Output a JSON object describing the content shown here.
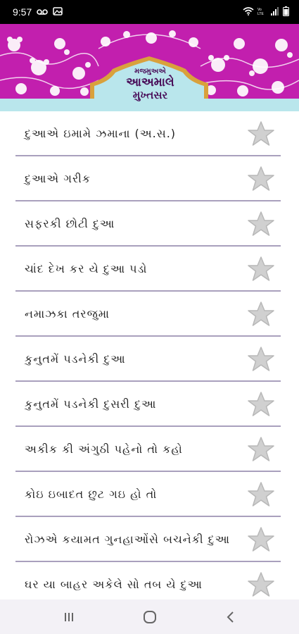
{
  "status_bar": {
    "time": "9:57",
    "icons": [
      "voicemail-icon",
      "gallery-icon",
      "wifi-icon",
      "volte-icon",
      "signal-icon",
      "battery-icon"
    ]
  },
  "header": {
    "title_line1": "મજમુઅએ",
    "title_line2": "આઅમાલે",
    "title_line3": "મુખ્તસર"
  },
  "colors": {
    "banner": "#c21fae",
    "banner_strip": "#b9e6ec",
    "divider": "#a9a0bd",
    "star": "#c9c9c9"
  },
  "list": {
    "items": [
      {
        "label": "દુઆએ ઇમામે ઝમાના (અ.સ.)",
        "icon": "star-outline-icon"
      },
      {
        "label": "દુઆએ ગરીક",
        "icon": "star-outline-icon"
      },
      {
        "label": "સફરકી છોટી દુઆ",
        "icon": "star-outline-icon"
      },
      {
        "label": "ચાંદ દેખ કર યે દુઆ પડો",
        "icon": "star-outline-icon"
      },
      {
        "label": "નમાઝકા તરજુમા",
        "icon": "star-outline-icon"
      },
      {
        "label": "કુનુતમેં પડનેકી દુઆ",
        "icon": "star-outline-icon"
      },
      {
        "label": "કુનુતમેં પડનેકી દુસરી દુઆ",
        "icon": "star-outline-icon"
      },
      {
        "label": "અકીક કી અંગુઠી પહેનો તો કહો",
        "icon": "star-outline-icon"
      },
      {
        "label": "કોઇ ઇબાદત છુટ ગઇ હો તો",
        "icon": "star-outline-icon"
      },
      {
        "label": "રોઝએ કયામત ગુનહાઓંસે બચનેકી દુઆ",
        "icon": "star-outline-icon"
      },
      {
        "label": "ઘર યા બાહર અકેલે સો તબ યે દુઆ",
        "icon": "star-outline-icon"
      }
    ]
  },
  "nav_bar": {
    "buttons": [
      "recent-apps-icon",
      "home-icon",
      "back-icon"
    ]
  }
}
